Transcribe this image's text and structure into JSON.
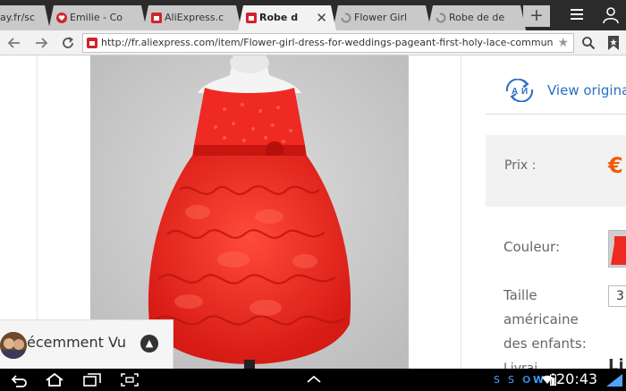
{
  "tabs": [
    {
      "label": "ay.fr/sc",
      "active": false
    },
    {
      "label": "Emilie - Co",
      "active": false
    },
    {
      "label": "AliExpress.c",
      "active": false
    },
    {
      "label": "Robe d",
      "active": true
    },
    {
      "label": "Flower Girl",
      "active": false
    },
    {
      "label": "Robe de de",
      "active": false
    }
  ],
  "toolbar": {
    "url": "http://fr.aliexpress.com/item/Flower-girl-dress-for-weddings-pageant-first-holy-lace-communion-dresses-for-little",
    "new_tab_label": "+",
    "close_tab_label": "✕"
  },
  "product": {
    "view_original": "View origina",
    "translate_icon_text": "A",
    "price_label": "Prix :",
    "price_currency": "€",
    "color_label": "Couleur:",
    "size_label_lines": [
      "Taille",
      "américaine",
      "des enfants:"
    ],
    "size_value": "3",
    "partial_label": "Livrai",
    "partial_value": "Li"
  },
  "recently_viewed": {
    "label": "écemment Vu"
  },
  "system_bar": {
    "time": "20:43",
    "status_icons": [
      "S",
      "S",
      "O",
      "W"
    ]
  },
  "colors": {
    "tabstrip": "#2b2b2b",
    "link": "#2a6fc1",
    "price": "#f05a00",
    "dress": "#ee2a22"
  }
}
